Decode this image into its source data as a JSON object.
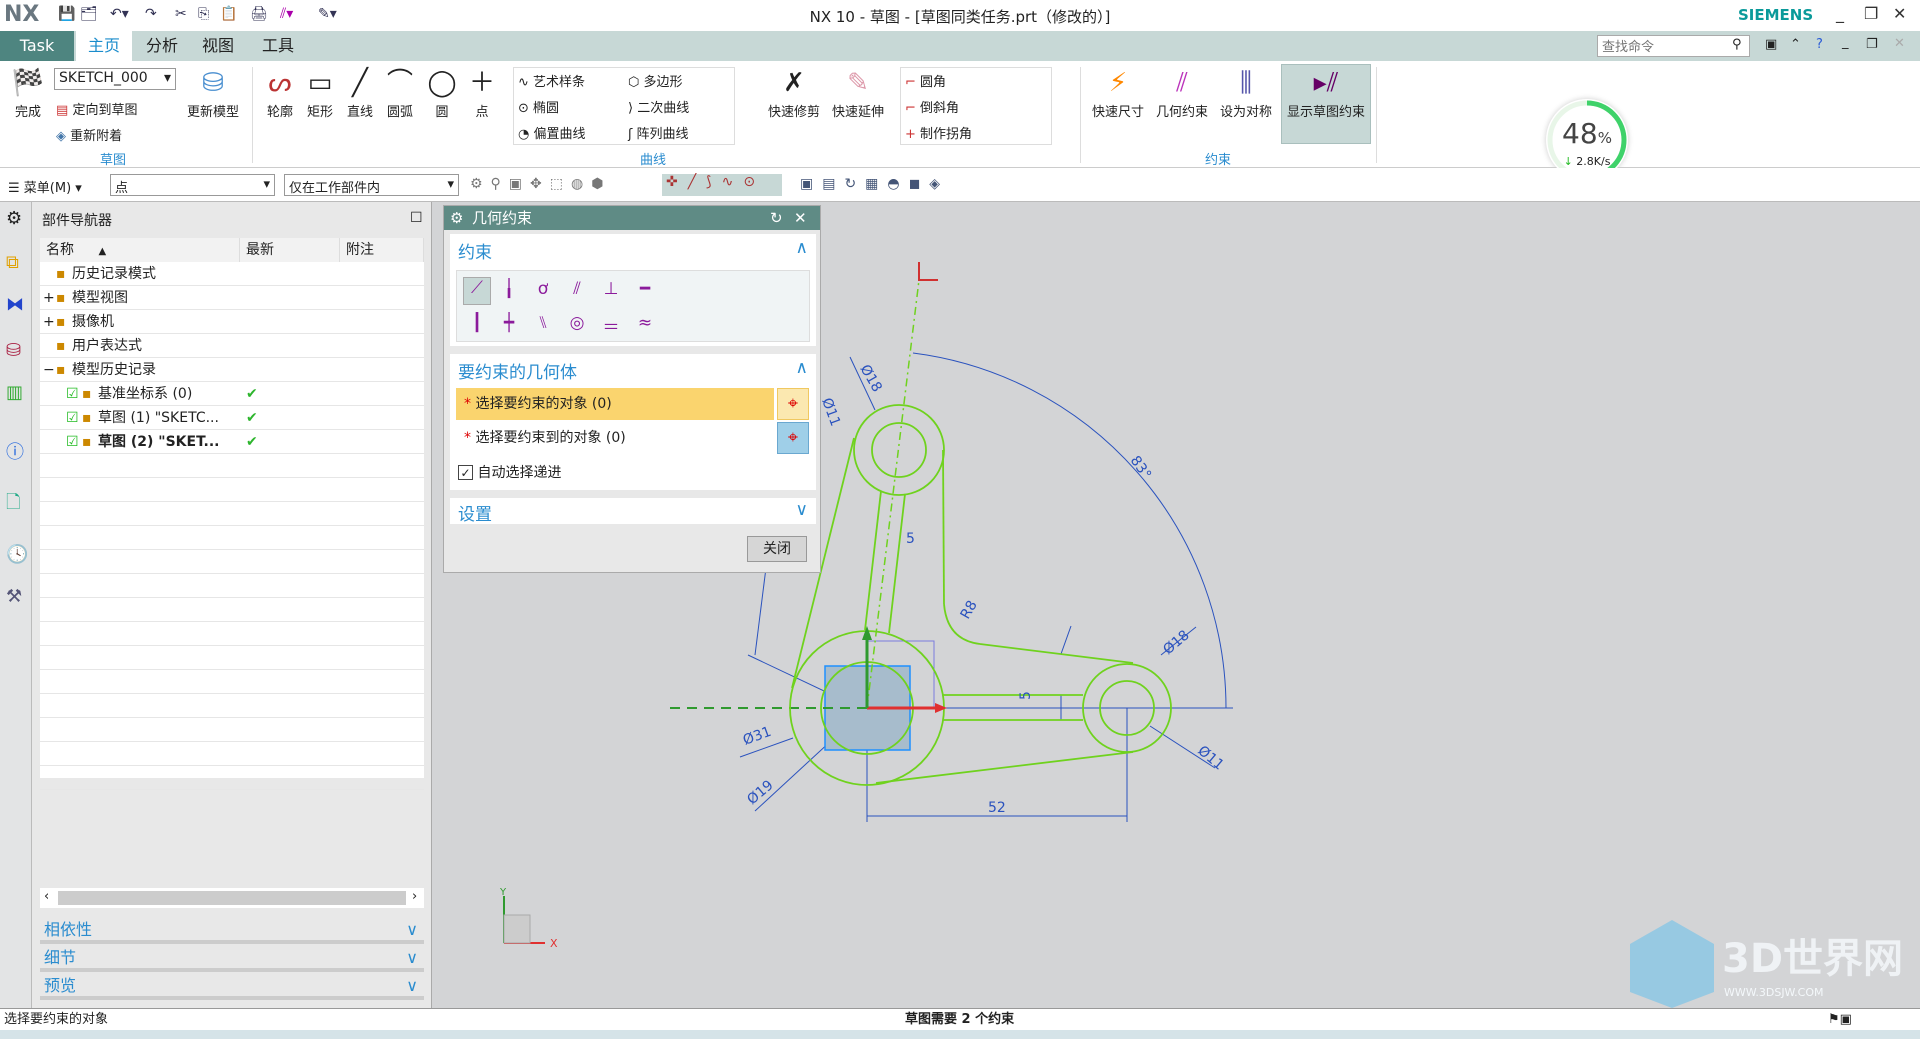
{
  "app": {
    "logo": "NX",
    "title": "NX 10 - 草图 - [草图同类任务.prt（修改的）]",
    "brand": "SIEMENS"
  },
  "tabs": [
    {
      "label": "Task"
    },
    {
      "label": "主页",
      "active": true
    },
    {
      "label": "分析"
    },
    {
      "label": "视图"
    },
    {
      "label": "工具"
    }
  ],
  "search": {
    "placeholder": "查找命令"
  },
  "ribbon": {
    "sketch_group": {
      "label": "草图",
      "finish": "完成",
      "sketch_name": "SKETCH_000",
      "orient": "定向到草图",
      "reattach": "重新附着",
      "update_model": "更新模型"
    },
    "curve_group": {
      "label": "曲线",
      "tools": [
        "轮廓",
        "矩形",
        "直线",
        "圆弧",
        "圆",
        "点"
      ],
      "list": [
        "艺术样条",
        "多边形",
        "椭圆",
        "二次曲线",
        "偏置曲线",
        "阵列曲线"
      ],
      "quick_trim": "快速修剪",
      "quick_extend": "快速延伸",
      "corner": [
        "圆角",
        "倒斜角",
        "制作拐角"
      ]
    },
    "constraint_group": {
      "label": "约束",
      "tools": [
        "快速尺寸",
        "几何约束",
        "设为对称",
        "显示草图约束"
      ]
    }
  },
  "network": {
    "percent": "48",
    "percent_sign": "%",
    "speed": "2.8K/s",
    "percent_value": 48
  },
  "toolbar2": {
    "menu": "菜单(M)",
    "filter": "点",
    "scope": "仅在工作部件内"
  },
  "navigator": {
    "title": "部件导航器",
    "columns": [
      "名称",
      "最新",
      "附注"
    ],
    "rows": [
      {
        "name": "历史记录模式",
        "icon": "clock-icon",
        "latest": ""
      },
      {
        "name": "模型视图",
        "icon": "model-views-icon",
        "latest": "",
        "expand": "+"
      },
      {
        "name": "摄像机",
        "icon": "camera-icon",
        "latest": "",
        "expand": "+"
      },
      {
        "name": "用户表达式",
        "icon": "folder-icon",
        "latest": ""
      },
      {
        "name": "模型历史记录",
        "icon": "folder-icon",
        "latest": "",
        "expand": "−"
      },
      {
        "name": "基准坐标系 (0)",
        "icon": "datum-csys-icon",
        "latest": "✔"
      },
      {
        "name": "草图 (1) \"SKETC...",
        "icon": "sketch-icon",
        "latest": "✔"
      },
      {
        "name": "草图 (2) \"SKET...",
        "icon": "sketch-icon",
        "latest": "✔",
        "bold": true
      }
    ],
    "sections": [
      "相依性",
      "细节",
      "预览"
    ]
  },
  "dialog": {
    "title": "几何约束",
    "constraint_section": "约束",
    "geometry_section": "要约束的几何体",
    "select_object": "选择要约束的对象 (0)",
    "select_target": "选择要约束到的对象 (0)",
    "auto_advance": "自动选择递进",
    "auto_advance_checked": true,
    "settings_section": "设置",
    "close": "关闭"
  },
  "sketch": {
    "dims": [
      "Ø18",
      "Ø11",
      "83°",
      "5",
      "R8",
      "Ø18",
      "5",
      "Ø31",
      "Ø19",
      "Ø11",
      "52"
    ],
    "colors": {
      "curve": "#6fd21e",
      "dimension": "#2a52be",
      "x_axis": "#e03030",
      "y_axis": "#2f9a2f"
    }
  },
  "status": {
    "left": "选择要约束的对象",
    "center": "草图需要 2 个约束"
  },
  "watermark": {
    "text": "3D世界网",
    "url": "WWW.3DSJW.COM"
  }
}
